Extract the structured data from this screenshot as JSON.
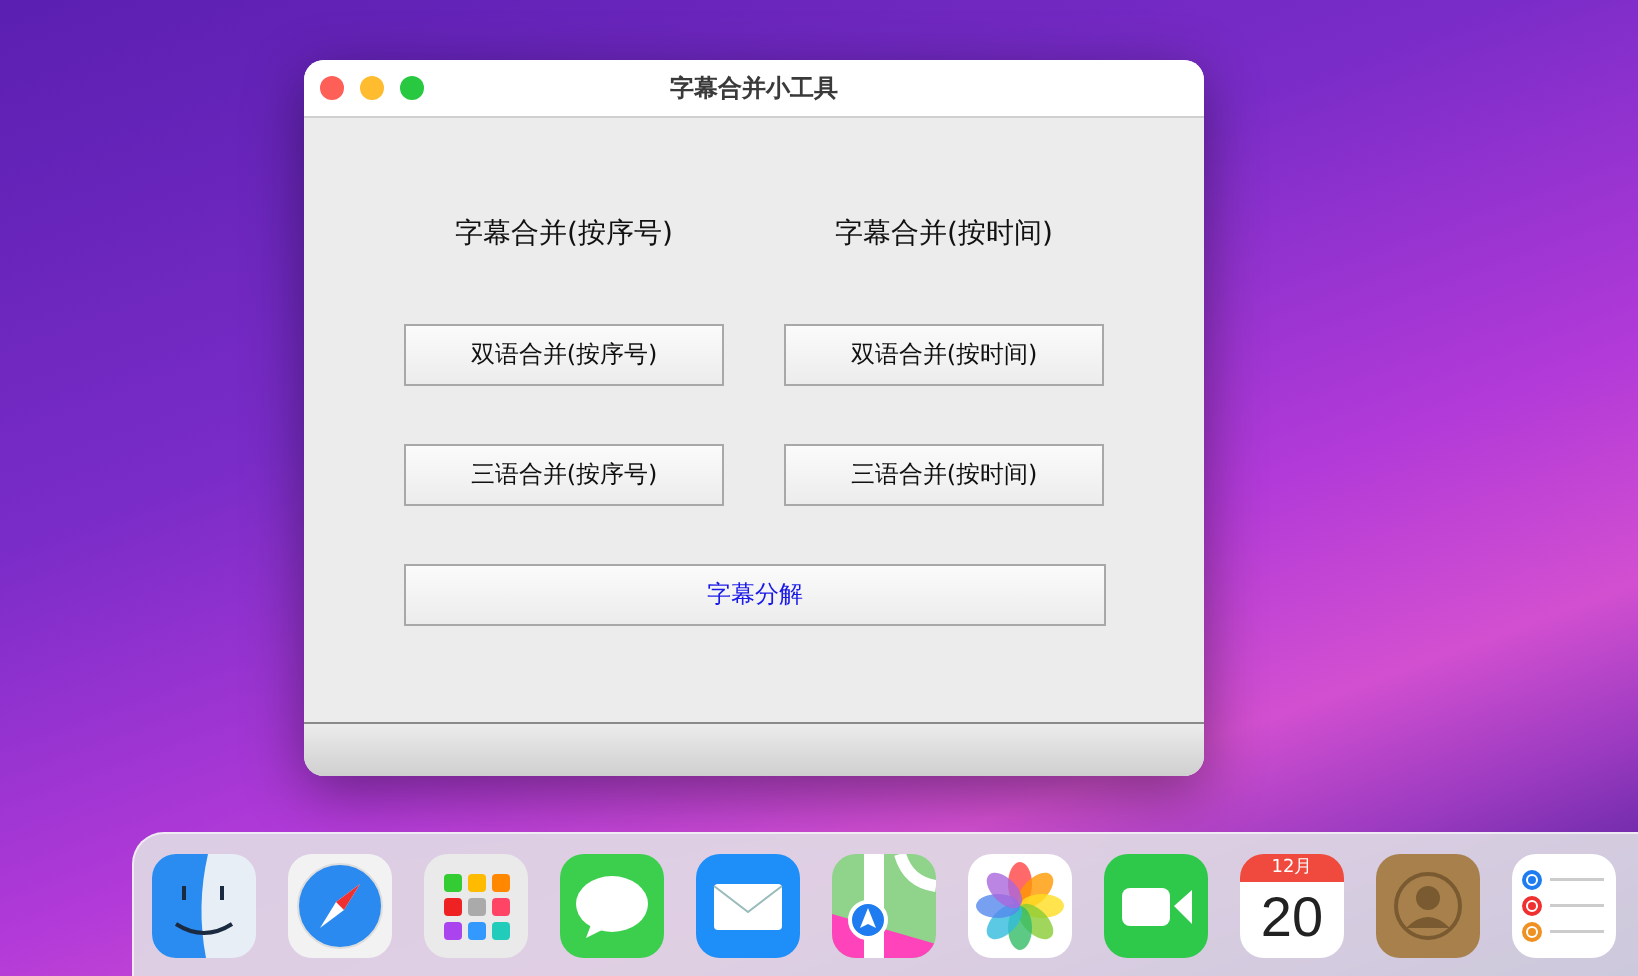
{
  "window": {
    "title": "字幕合并小工具"
  },
  "headings": [
    "字幕合并(按序号)",
    "字幕合并(按时间)"
  ],
  "buttons": [
    {
      "label": "双语合并(按序号)"
    },
    {
      "label": "双语合并(按时间)"
    },
    {
      "label": "三语合并(按序号)"
    },
    {
      "label": "三语合并(按时间)"
    }
  ],
  "split_button": {
    "label": "字幕分解"
  },
  "dock": [
    {
      "kind": "finder"
    },
    {
      "kind": "safari"
    },
    {
      "kind": "launchpad"
    },
    {
      "kind": "messages"
    },
    {
      "kind": "mail"
    },
    {
      "kind": "maps"
    },
    {
      "kind": "photos"
    },
    {
      "kind": "facetime"
    },
    {
      "kind": "calendar",
      "month": "12月",
      "day": "20"
    },
    {
      "kind": "contacts"
    },
    {
      "kind": "reminders"
    }
  ]
}
